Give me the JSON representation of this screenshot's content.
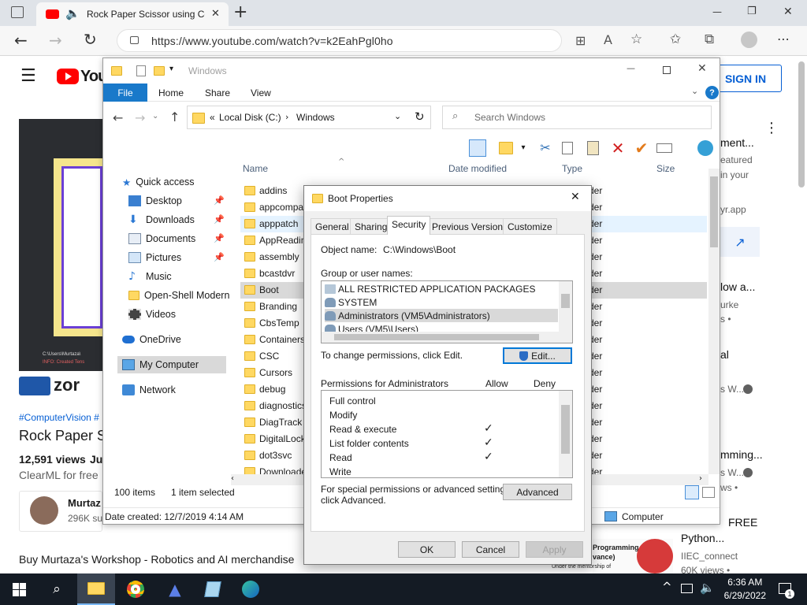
{
  "browser": {
    "tab_title": "Rock Paper Scissor using Computer Vision",
    "url": "https://www.youtube.com/watch?v=k2EahPgl0ho",
    "add_tab_symbol": "+",
    "minimize_symbol": "—",
    "restore_symbol": "❐",
    "close_symbol": "✕"
  },
  "youtube": {
    "logo_text": "You",
    "sign_in": "SIGN IN",
    "hashtags": "#ComputerVision #",
    "video_title": "Rock Paper S",
    "views": "12,591 views",
    "date_prefix": "Ju",
    "description": "ClearML for free",
    "channel_name": "Murtaz",
    "subscribers": "296K su",
    "merch": "Buy Murtaza's Workshop - Robotics and AI merchandise",
    "thumb_banner": "zor",
    "thumb_terminal_1": "C:\\Users\\Murtaza\\",
    "thumb_terminal_2": "INFO: Created Tens",
    "right_col": [
      {
        "title": "ment...",
        "sub1": "eatured",
        "sub2": "in your"
      },
      {
        "title": "",
        "sub1": "yr.app",
        "sub2": ""
      },
      {
        "title": "low a...",
        "sub1": "urke",
        "sub2": "s •"
      },
      {
        "title": "al",
        "sub1": "",
        "sub2": "s W..."
      },
      {
        "title": "mming...",
        "sub1": "s W...",
        "sub2": "ws •"
      },
      {
        "title": "Python...",
        "sub1": "IIEC_connect",
        "sub2": "60K views •"
      }
    ],
    "right_extra_title": "FREE",
    "ad_text_1": "Programming",
    "ad_text_2": "vance)",
    "ad_text_3": "Under the mentorship of"
  },
  "explorer": {
    "title": "Windows",
    "ribbon_tabs": [
      "File",
      "Home",
      "Share",
      "View"
    ],
    "path_root": "Local Disk (C:)",
    "path_current": "Windows",
    "path_overflow": "«",
    "search_placeholder": "Search Windows",
    "columns": {
      "name": "Name",
      "date": "Date modified",
      "type": "Type",
      "size": "Size"
    },
    "nav": [
      {
        "label": "Quick access",
        "icon": "star-icon",
        "pinned": false
      },
      {
        "label": "Desktop",
        "icon": "desktop-icon",
        "pinned": true
      },
      {
        "label": "Downloads",
        "icon": "download-icon",
        "pinned": true
      },
      {
        "label": "Documents",
        "icon": "documents-icon",
        "pinned": true
      },
      {
        "label": "Pictures",
        "icon": "pictures-icon",
        "pinned": true
      },
      {
        "label": "Music",
        "icon": "music-icon",
        "pinned": false
      },
      {
        "label": "Open-Shell Modern",
        "icon": "folder-icon",
        "pinned": false
      },
      {
        "label": "Videos",
        "icon": "videos-icon",
        "pinned": false
      },
      {
        "label": "OneDrive",
        "icon": "cloud-icon",
        "pinned": false
      },
      {
        "label": "My Computer",
        "icon": "computer-icon",
        "pinned": false
      },
      {
        "label": "Network",
        "icon": "network-icon",
        "pinned": false
      }
    ],
    "files": [
      "addins",
      "appcompat",
      "apppatch",
      "AppReadiness",
      "assembly",
      "bcastdvr",
      "Boot",
      "Branding",
      "CbsTemp",
      "Containers",
      "CSC",
      "Cursors",
      "debug",
      "diagnostics",
      "DiagTrack",
      "DigitalLocker",
      "dot3svc",
      "Downloaded"
    ],
    "file_type_fragment": "der",
    "item_count": "100 items",
    "selected_count": "1 item selected",
    "date_created": "Date created: 12/7/2019 4:14 AM",
    "computer_label": "Computer"
  },
  "dialog": {
    "title": "Boot Properties",
    "tabs": [
      "General",
      "Sharing",
      "Security",
      "Previous Versions",
      "Customize"
    ],
    "active_tab": "Security",
    "object_label": "Object name:",
    "object_value": "C:\\Windows\\Boot",
    "group_label": "Group or user names:",
    "groups": [
      "ALL RESTRICTED APPLICATION PACKAGES",
      "SYSTEM",
      "Administrators (VM5\\Administrators)",
      "Users (VM5\\Users)"
    ],
    "change_text": "To change permissions, click Edit.",
    "edit_button": "Edit...",
    "perms_label": "Permissions for Administrators",
    "allow_label": "Allow",
    "deny_label": "Deny",
    "permissions": [
      {
        "name": "Full control",
        "allow": false
      },
      {
        "name": "Modify",
        "allow": false
      },
      {
        "name": "Read & execute",
        "allow": true
      },
      {
        "name": "List folder contents",
        "allow": true
      },
      {
        "name": "Read",
        "allow": true
      },
      {
        "name": "Write",
        "allow": false
      }
    ],
    "check_mark": "✓",
    "special_text_1": "For special permissions or advanced settings,",
    "special_text_2": "click Advanced.",
    "advanced_button": "Advanced",
    "ok": "OK",
    "cancel": "Cancel",
    "apply": "Apply"
  },
  "taskbar": {
    "time": "6:36 AM",
    "date": "6/29/2022",
    "notification_count": "1"
  }
}
